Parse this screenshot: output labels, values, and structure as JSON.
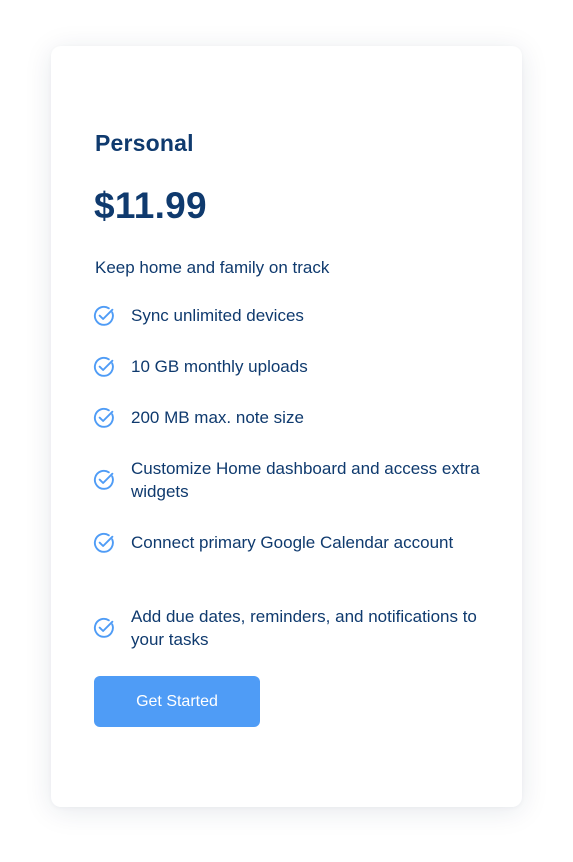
{
  "plan": {
    "name": "Personal",
    "price": "$11.99",
    "tagline": "Keep home and family on track"
  },
  "features": [
    {
      "label": "Sync unlimited devices"
    },
    {
      "label": "10 GB monthly uploads"
    },
    {
      "label": "200 MB max. note size"
    },
    {
      "label": "Customize Home dashboard and access extra widgets"
    },
    {
      "label": "Connect primary Google Calendar account"
    },
    {
      "label": "Add due dates, reminders, and notifications to your tasks"
    }
  ],
  "cta": {
    "label": "Get Started"
  },
  "colors": {
    "text_primary": "#0f3a6e",
    "accent": "#4f9cf6",
    "card_background": "#ffffff"
  },
  "icons": {
    "feature_icon": "check-circle-icon"
  }
}
